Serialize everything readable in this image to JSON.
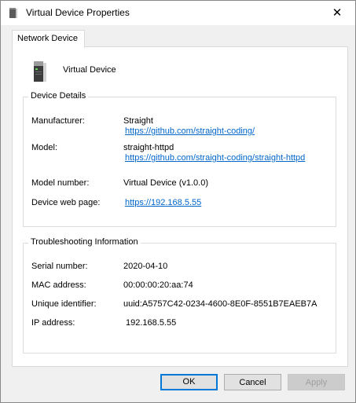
{
  "window": {
    "title": "Virtual Device Properties",
    "close_symbol": "✕"
  },
  "tabs": [
    {
      "label": "Network Device"
    }
  ],
  "device": {
    "name": "Virtual Device",
    "icon": "server-device-icon"
  },
  "details": {
    "legend": "Device Details",
    "manufacturer_label": "Manufacturer:",
    "manufacturer_name": "Straight",
    "manufacturer_url": "https://github.com/straight-coding/",
    "model_label": "Model:",
    "model_name": "straight-httpd",
    "model_url": "https://github.com/straight-coding/straight-httpd",
    "model_number_label": "Model number:",
    "model_number": "Virtual Device (v1.0.0)",
    "web_page_label": "Device web page:",
    "web_page_url": "https://192.168.5.55"
  },
  "troubleshooting": {
    "legend": "Troubleshooting Information",
    "serial_label": "Serial number:",
    "serial": "2020-04-10",
    "mac_label": "MAC address:",
    "mac": "00:00:00:20:aa:74",
    "uid_label": "Unique identifier:",
    "uid": "uuid:A5757C42-0234-4600-8E0F-8551B7EAEB7A",
    "ip_label": "IP address:",
    "ip": "192.168.5.55"
  },
  "buttons": {
    "ok": "OK",
    "cancel": "Cancel",
    "apply": "Apply"
  },
  "colors": {
    "accent": "#0078d7",
    "link": "#0066cc"
  }
}
